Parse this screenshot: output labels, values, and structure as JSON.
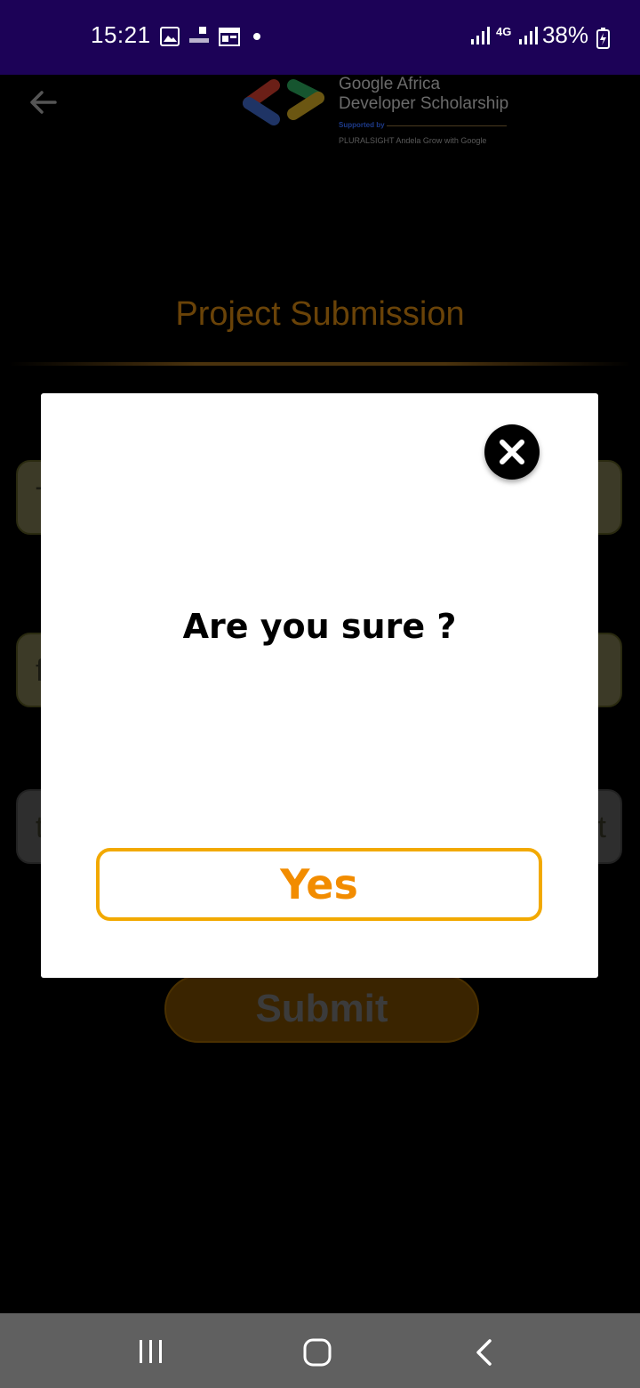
{
  "status_bar": {
    "time": "15:21",
    "network": "4G",
    "battery": "38%",
    "icons": [
      "image-icon",
      "gtbank-icon",
      "calendar-icon",
      "dot-icon",
      "signal-icon",
      "signal-icon",
      "battery-charging-icon"
    ]
  },
  "header": {
    "back_icon": "arrow-left-icon",
    "logo": {
      "title_line1": "Google Africa",
      "title_line2": "Developer Scholarship",
      "supported_by": "Supported by",
      "partners": "PLURALSIGHT   Andela   Grow with Google"
    }
  },
  "page": {
    "title": "Project Submission",
    "fields": [
      {
        "text": "T",
        "tail": ""
      },
      {
        "text": "f",
        "tail": ""
      },
      {
        "text": "t",
        "tail": "t"
      }
    ],
    "submit_label": "Submit"
  },
  "dialog": {
    "message": "Are you sure ?",
    "confirm_label": "Yes",
    "close_icon": "close-icon"
  },
  "nav_bar": {
    "icons": [
      "recent-apps-icon",
      "home-icon",
      "back-icon"
    ]
  },
  "colors": {
    "status_bar": "#1c0257",
    "accent_orange": "#f28c00",
    "accent_border": "#f2a900"
  }
}
